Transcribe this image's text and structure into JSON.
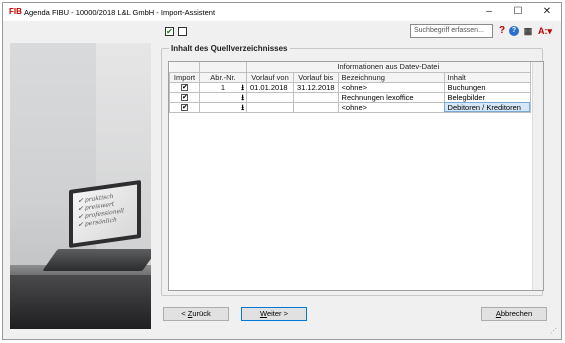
{
  "window": {
    "title": "Agenda FIBU - 10000/2018 L&L GmbH - Import-Assistent",
    "app_logo": "FIB",
    "controls": {
      "minimize": "–",
      "maximize": "☐",
      "close": "✕"
    }
  },
  "toolbar": {
    "checkbox1_checked": true,
    "checkbox2_checked": false,
    "search": {
      "placeholder": "Suchbegriff erfassen...",
      "value": ""
    },
    "icons": [
      "help-question-icon",
      "info-icon",
      "calculator-icon",
      "agenda-menu-icon"
    ]
  },
  "side_image": {
    "screen_lines": [
      "✔ praktisch",
      "✔ preiswert",
      "✔ professionell",
      "✔ persönlich"
    ]
  },
  "group": {
    "title": "Inhalt des Quellverzeichnisses",
    "header_group": "Informationen aus Datev-Datei",
    "columns": {
      "import": "Import",
      "abr_nr": "Abr.-Nr.",
      "vorlauf_von": "Vorlauf von",
      "vorlauf_bis": "Vorlauf bis",
      "bezeichnung": "Bezeichnung",
      "inhalt": "Inhalt"
    },
    "rows": [
      {
        "import": true,
        "abr_nr": "1",
        "vorlauf_von": "01.01.2018",
        "vorlauf_bis": "31.12.2018",
        "bezeichnung": "<ohne>",
        "inhalt": "Buchungen"
      },
      {
        "import": true,
        "abr_nr": "",
        "vorlauf_von": "",
        "vorlauf_bis": "",
        "bezeichnung": "Rechnungen lexoffice",
        "inhalt": "Belegbilder"
      },
      {
        "import": true,
        "abr_nr": "",
        "vorlauf_von": "",
        "vorlauf_bis": "",
        "bezeichnung": "<ohne>",
        "inhalt": "Debitoren / Kreditoren"
      }
    ]
  },
  "buttons": {
    "back": {
      "prefix": "< ",
      "mnemonic": "Z",
      "rest": "urück"
    },
    "next": {
      "mnemonic": "W",
      "rest": "eiter >"
    },
    "cancel": {
      "mnemonic": "A",
      "rest": "bbrechen"
    }
  },
  "colors": {
    "selection": "#d6e8f8",
    "accent": "#0078d7",
    "logo": "#c00000"
  }
}
